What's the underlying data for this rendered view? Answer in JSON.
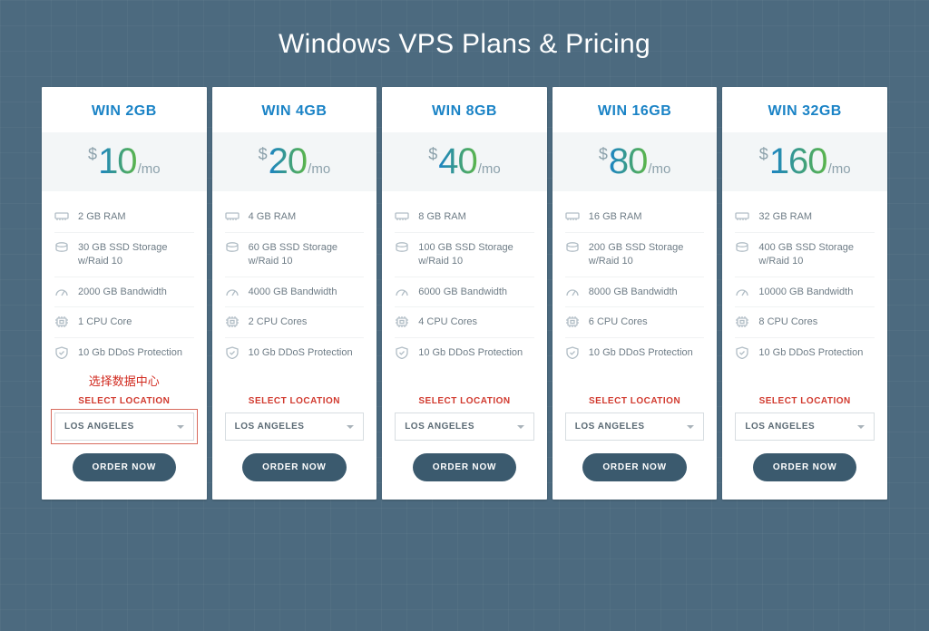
{
  "title": "Windows VPS Plans & Pricing",
  "common": {
    "currency": "$",
    "per": "/mo",
    "select_label": "SELECT LOCATION",
    "location": "LOS ANGELES",
    "order_label": "ORDER NOW",
    "annotation": "选择数据中心"
  },
  "plans": [
    {
      "name": "WIN 2GB",
      "price": "10",
      "features": [
        {
          "icon": "ram",
          "text": "2 GB RAM"
        },
        {
          "icon": "disk",
          "text": "30 GB SSD Storage w/Raid 10"
        },
        {
          "icon": "gauge",
          "text": "2000 GB Bandwidth"
        },
        {
          "icon": "cpu",
          "text": "1 CPU Core"
        },
        {
          "icon": "shield",
          "text": "10 Gb DDoS Protection"
        }
      ],
      "highlight": true
    },
    {
      "name": "WIN 4GB",
      "price": "20",
      "features": [
        {
          "icon": "ram",
          "text": "4 GB RAM"
        },
        {
          "icon": "disk",
          "text": "60 GB SSD Storage w/Raid 10"
        },
        {
          "icon": "gauge",
          "text": "4000 GB Bandwidth"
        },
        {
          "icon": "cpu",
          "text": "2 CPU Cores"
        },
        {
          "icon": "shield",
          "text": "10 Gb DDoS Protection"
        }
      ],
      "highlight": false
    },
    {
      "name": "WIN 8GB",
      "price": "40",
      "features": [
        {
          "icon": "ram",
          "text": "8 GB RAM"
        },
        {
          "icon": "disk",
          "text": "100 GB SSD Storage w/Raid 10"
        },
        {
          "icon": "gauge",
          "text": "6000 GB Bandwidth"
        },
        {
          "icon": "cpu",
          "text": "4 CPU Cores"
        },
        {
          "icon": "shield",
          "text": "10 Gb DDoS Protection"
        }
      ],
      "highlight": false
    },
    {
      "name": "WIN 16GB",
      "price": "80",
      "features": [
        {
          "icon": "ram",
          "text": "16 GB RAM"
        },
        {
          "icon": "disk",
          "text": "200 GB SSD Storage w/Raid 10"
        },
        {
          "icon": "gauge",
          "text": "8000 GB Bandwidth"
        },
        {
          "icon": "cpu",
          "text": "6 CPU Cores"
        },
        {
          "icon": "shield",
          "text": "10 Gb DDoS Protection"
        }
      ],
      "highlight": false
    },
    {
      "name": "WIN 32GB",
      "price": "160",
      "features": [
        {
          "icon": "ram",
          "text": "32 GB RAM"
        },
        {
          "icon": "disk",
          "text": "400 GB SSD Storage w/Raid 10"
        },
        {
          "icon": "gauge",
          "text": "10000 GB Bandwidth"
        },
        {
          "icon": "cpu",
          "text": "8 CPU Cores"
        },
        {
          "icon": "shield",
          "text": "10 Gb DDoS Protection"
        }
      ],
      "highlight": false
    }
  ]
}
